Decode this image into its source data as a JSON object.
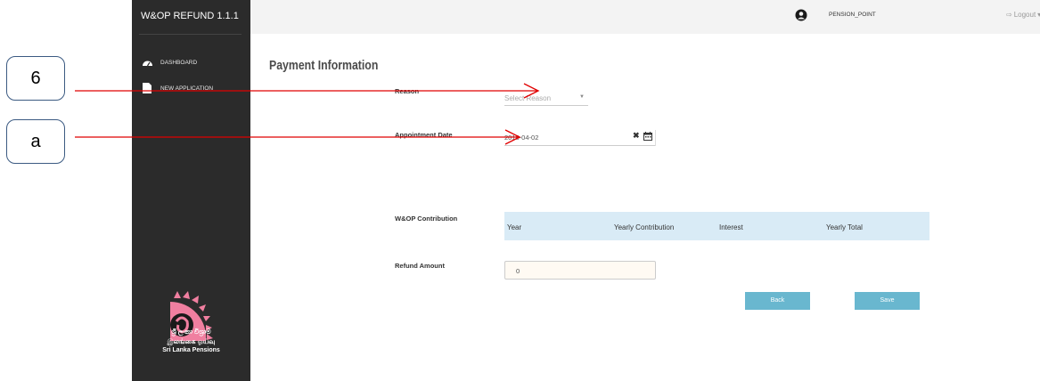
{
  "app": {
    "title": "W&OP REFUND 1.1.1"
  },
  "sidebar": {
    "items": [
      {
        "label": "DASHBOARD",
        "icon": "dashboard-icon"
      },
      {
        "label": "NEW APPLICATION",
        "icon": "document-icon"
      }
    ],
    "logo": {
      "sinhala": "ශ්‍රී ලංකා විශ්‍රාම",
      "tamil": "இலங்கை ஓய்வு",
      "english": "Sri Lanka Pensions"
    }
  },
  "topbar": {
    "user": "PENSION_POINT",
    "logout": "Logout"
  },
  "page": {
    "title": "Payment Information"
  },
  "form": {
    "reason_label": "Reason",
    "reason_placeholder": "Select Reason",
    "appointment_label": "Appointment Date",
    "appointment_value": "2018-04-02",
    "contribution_label": "W&OP Contribution",
    "refund_label": "Refund Amount",
    "refund_value": "0"
  },
  "table": {
    "columns": [
      "Year",
      "Yearly Contribution",
      "Interest",
      "Yearly Total"
    ]
  },
  "buttons": {
    "back": "Back",
    "save": "Save"
  },
  "annotations": {
    "callout_1": "6",
    "callout_2": "a"
  },
  "colors": {
    "sidebar_bg": "#2b2b2b",
    "button": "#69b7cf",
    "table_header": "#d9ebf6",
    "arrow": "#e00000",
    "logo_pink": "#f07fa0"
  }
}
